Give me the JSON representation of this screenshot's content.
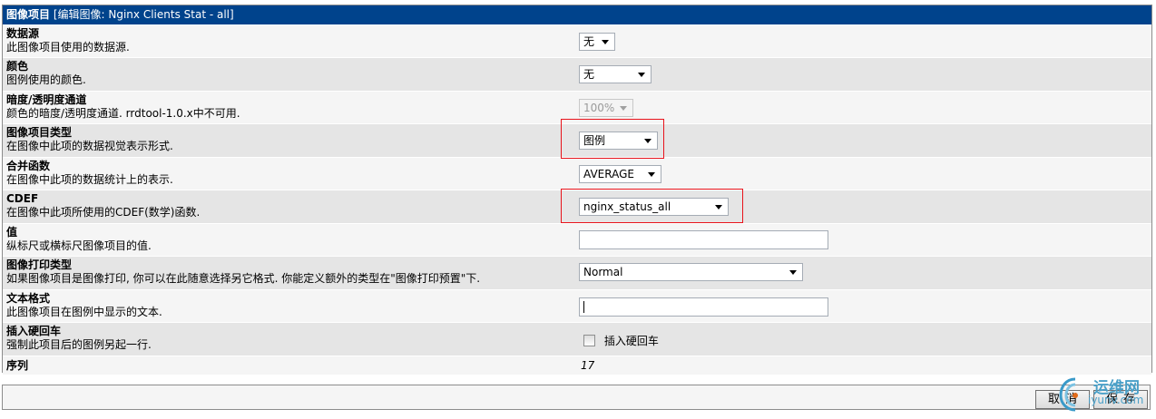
{
  "header": {
    "title": "图像项目",
    "subtitle": "[编辑图像: Nginx Clients Stat - all]"
  },
  "fields": {
    "data_source": {
      "label": "数据源",
      "desc": "此图像项目使用的数据源.",
      "value": "无"
    },
    "color": {
      "label": "颜色",
      "desc": "图例使用的颜色.",
      "value": "无"
    },
    "opacity": {
      "label": "暗度/透明度通道",
      "desc": "颜色的暗度/透明度通道. rrdtool-1.0.x中不可用.",
      "value": "100%"
    },
    "item_type": {
      "label": "图像项目类型",
      "desc": "在图像中此项的数据视觉表示形式.",
      "value": "图例"
    },
    "consolidation": {
      "label": "合并函数",
      "desc": "在图像中此项的数据统计上的表示.",
      "value": "AVERAGE"
    },
    "cdef": {
      "label": "CDEF",
      "desc": "在图像中此项所使用的CDEF(数学)函数.",
      "value": "nginx_status_all"
    },
    "value": {
      "label": "值",
      "desc": "纵标尺或横标尺图像项目的值.",
      "value": ""
    },
    "gprint_type": {
      "label": "图像打印类型",
      "desc": "如果图像项目是图像打印, 你可以在此随意选择另它格式. 你能定义额外的类型在\"图像打印预置\"下.",
      "value": "Normal"
    },
    "text_format": {
      "label": "文本格式",
      "desc": "此图像项目在图例中显示的文本.",
      "value": ""
    },
    "hard_return": {
      "label": "插入硬回车",
      "desc": "强制此项目后的图例另起一行.",
      "checkbox_label": "插入硬回车"
    },
    "sequence": {
      "label": "序列",
      "value": "17"
    }
  },
  "buttons": {
    "cancel": "取消",
    "save": "保存"
  },
  "watermark": {
    "text": "运维网",
    "url": "iyunv.com"
  },
  "colors": {
    "header_bg": "#00438c",
    "highlight": "#e8131b"
  }
}
